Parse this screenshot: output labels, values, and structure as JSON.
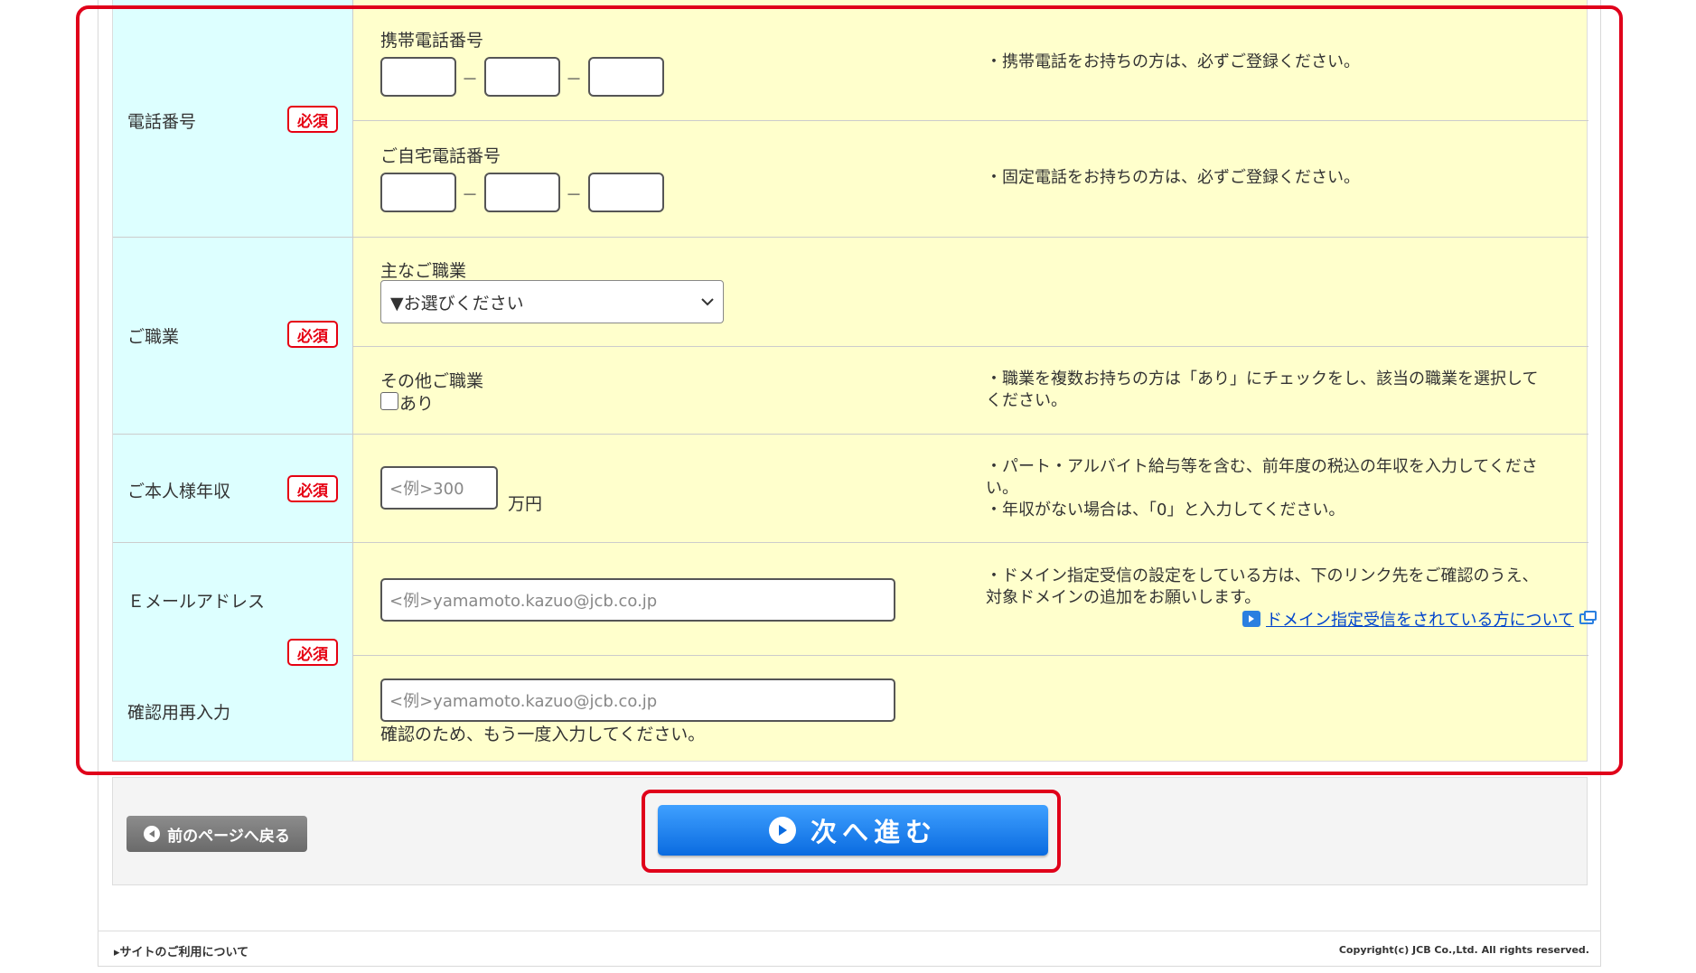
{
  "form": {
    "phone": {
      "label": "電話番号",
      "required": "必須",
      "mobile_label": "携帯電話番号",
      "mobile_note": "・携帯電話をお持ちの方は、必ずご登録ください。",
      "home_label": "ご自宅電話番号",
      "home_note": "・固定電話をお持ちの方は、必ずご登録ください。",
      "dash": "－"
    },
    "occupation": {
      "label": "ご職業",
      "required": "必須",
      "main_label": "主なご職業",
      "select_value": "▼お選びください",
      "other_label": "その他ご職業",
      "checkbox_label": "あり",
      "note_line1": "・職業を複数お持ちの方は「あり」にチェックをし、該当の職業を選択して",
      "note_line2": "ください。"
    },
    "income": {
      "label": "ご本人様年収",
      "required": "必須",
      "placeholder": "<例>300",
      "unit": "万円",
      "note_line1": "・パート・アルバイト給与等を含む、前年度の税込の年収を入力してくださ",
      "note_line2": "い。",
      "note_line3": "・年収がない場合は、「0」と入力してください。"
    },
    "email": {
      "label": "Ｅメールアドレス",
      "required": "必須",
      "placeholder": "<例>yamamoto.kazuo@jcb.co.jp",
      "note_line1": "・ドメイン指定受信の設定をしている方は、下のリンク先をご確認のうえ、",
      "note_line2": "対象ドメインの追加をお願いします。",
      "link_text": "ドメイン指定受信をされている方について",
      "confirm_label": "確認用再入力",
      "confirm_placeholder": "<例>yamamoto.kazuo@jcb.co.jp",
      "confirm_note": "確認のため、もう一度入力してください。"
    }
  },
  "nav": {
    "back_label": "前のページへ戻る",
    "next_label": "次へ進む"
  },
  "footer": {
    "site_link": "▸サイトのご利用について",
    "copyright": "Copyright(c) JCB Co.,Ltd. All rights reserved."
  },
  "colors": {
    "label_bg": "#ddffff",
    "field_bg": "#ffffcc",
    "required_red": "#e60012",
    "next_blue": "#0a6be0",
    "highlight_outline": "#e0001a"
  }
}
